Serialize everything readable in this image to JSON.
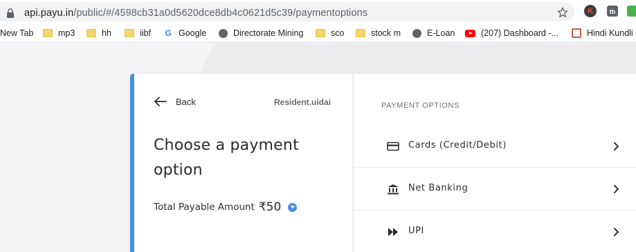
{
  "browser": {
    "url_host": "api.payu.in",
    "url_path": "/public/#/4598cb31a0d5620dce8db4c0621d5c39/paymentoptions",
    "extension_k": "K",
    "extension_tb": "tb"
  },
  "bookmarks": [
    {
      "label": "New Tab",
      "icon": "none"
    },
    {
      "label": "mp3",
      "icon": "folder-icon"
    },
    {
      "label": "hh",
      "icon": "folder-icon"
    },
    {
      "label": "iibf",
      "icon": "folder-icon"
    },
    {
      "label": "Google",
      "icon": "google-icon"
    },
    {
      "label": "Directorate Mining",
      "icon": "globe-icon"
    },
    {
      "label": "sco",
      "icon": "folder-icon"
    },
    {
      "label": "stock m",
      "icon": "folder-icon"
    },
    {
      "label": "E-Loan",
      "icon": "globe-icon"
    },
    {
      "label": "(207) Dashboard -...",
      "icon": "youtube-icon"
    },
    {
      "label": "Hindi Kundli I",
      "icon": "kundli-icon"
    }
  ],
  "payment": {
    "back_label": "Back",
    "merchant": "Resident.uidai",
    "heading": "Choose a payment option",
    "total_label": "Total Payable Amount",
    "total_amount": "₹50",
    "options_title": "PAYMENT OPTIONS",
    "options": [
      {
        "label": "Cards (Credit/Debit)",
        "icon": "card-icon"
      },
      {
        "label": "Net Banking",
        "icon": "bank-icon"
      },
      {
        "label": "UPI",
        "icon": "upi-icon"
      }
    ]
  },
  "colors": {
    "accent": "#4a90d9",
    "page_bg": "#f4f5f7"
  }
}
